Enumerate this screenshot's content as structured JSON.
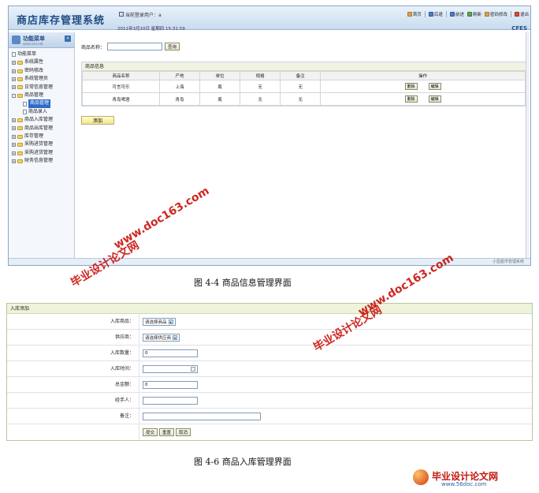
{
  "top_window": {
    "app_title": "商店库存管理系统",
    "user_label": "当前登录用户：",
    "user_value": "a",
    "date_text": "2011年3月10日  星期四  15:31:59",
    "brand": "CFES",
    "toolbar": [
      "首页",
      "后退",
      "前进",
      "刷新",
      "密码修改",
      "退出"
    ],
    "sidebar": {
      "title": "功能菜单",
      "subtitle": "www.xxx.net",
      "root": "功能菜单",
      "items": [
        "系统属性",
        "密码修改",
        "系统管理员",
        "日常信息管理",
        "商品管理",
        "商品入库管理",
        "商品出库管理",
        "库存管理",
        "采购进货管理",
        "采购进货管理",
        "财务信息管理"
      ],
      "children": [
        "商品管理",
        "商品录入"
      ]
    },
    "search": {
      "label": "商品名称：",
      "value": "",
      "button": "查询"
    },
    "panel_title": "商品信息",
    "table": {
      "headers": [
        "商品名称",
        "产地",
        "单位",
        "规格",
        "备注",
        "操作"
      ],
      "rows": [
        [
          "可言可乐",
          "上海",
          "瓶",
          "无",
          "无"
        ],
        [
          "青岛啤酒",
          "青岛",
          "瓶",
          "无",
          "无"
        ]
      ],
      "actions": [
        "删除",
        "编辑"
      ]
    },
    "add_button": "添加",
    "status_text": "小型超市管理系统"
  },
  "caption1": "图 4-4  商品信息管理界面",
  "form": {
    "title": "入库添加",
    "fields": [
      {
        "label": "入库商品：",
        "value": "请选择商品"
      },
      {
        "label": "供应商：",
        "value": "请选择供应商"
      },
      {
        "label": "入库数量：",
        "value": "0"
      },
      {
        "label": "入库时间：",
        "value": ""
      },
      {
        "label": "总金额：",
        "value": "0"
      },
      {
        "label": "经手人：",
        "value": ""
      },
      {
        "label": "备注：",
        "value": ""
      }
    ],
    "buttons": [
      "提交",
      "重置",
      "取消"
    ]
  },
  "caption2": "图 4-6  商品入库管理界面",
  "watermarks": {
    "site": "www.doc163.com",
    "name": "毕业设计论文网",
    "logo_name": "毕业设计论文网",
    "logo_url": "www.56doc.com"
  }
}
